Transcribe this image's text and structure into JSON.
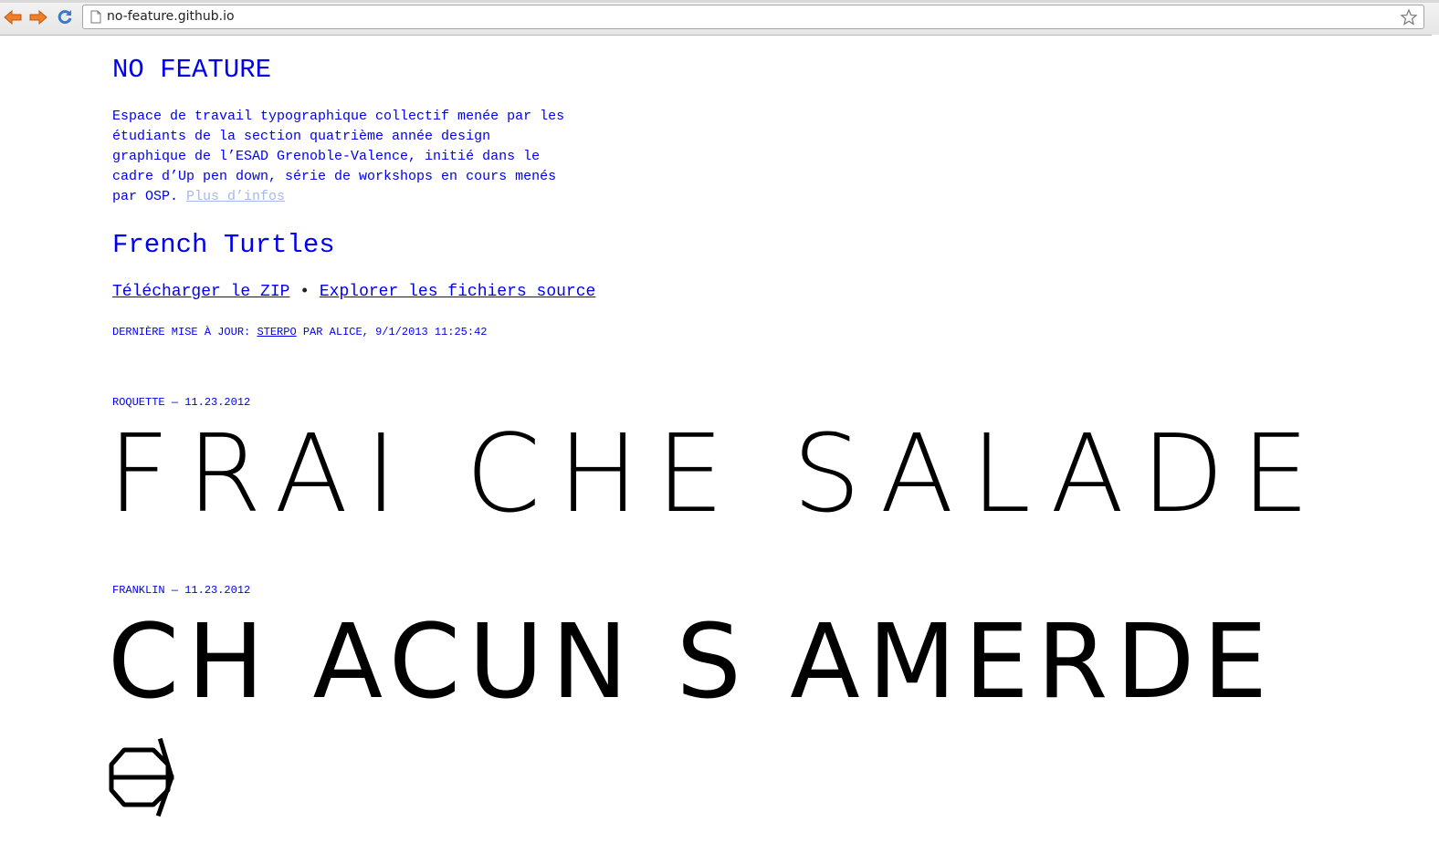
{
  "browser": {
    "url": "no-feature.github.io",
    "icons": [
      "back-arrow-icon",
      "forward-arrow-icon",
      "reload-icon",
      "page-icon",
      "star-icon"
    ]
  },
  "page": {
    "site_title": "NO FEATURE",
    "intro_lines": [
      "Espace de travail typographique collectif menée par les",
      "étudiants de la section quatrième année design",
      "graphique de l’ESAD Grenoble-Valence, initié dans le",
      "cadre d’Up pen down, série de workshops en cours menés",
      "par OSP. "
    ],
    "more_link": "Plus d’infos",
    "project_title": "French Turtles",
    "download_link": "Télécharger le ZIP",
    "separator": "•",
    "explore_link": "Explorer les fichiers source",
    "update_prefix": "Dernière mise à jour: ",
    "update_author": "sterpo",
    "update_suffix": " par Alice, 9/1/2013 11:25:42",
    "specimens": [
      {
        "caption": "ROQUETTE — 11.23.2012",
        "sample": "FRAI CHE  SALADE"
      },
      {
        "caption": "FRANKLIN — 11.23.2012",
        "sample": "CH ACUN S AMERDE"
      }
    ],
    "colors": {
      "link": "#0000ee",
      "visited_link": "#a8b8ef",
      "text_black": "#000000"
    }
  }
}
